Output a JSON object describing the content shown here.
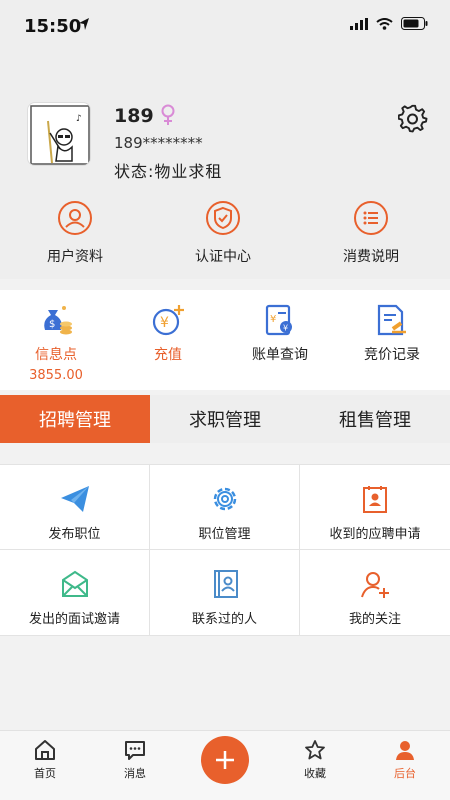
{
  "status_bar": {
    "time": "15:50"
  },
  "profile": {
    "name": "189",
    "phone": "189********",
    "status": "状态:物业求租"
  },
  "header_actions": [
    {
      "label": "用户资料",
      "icon": "user-profile-icon"
    },
    {
      "label": "认证中心",
      "icon": "shield-check-icon"
    },
    {
      "label": "消费说明",
      "icon": "list-doc-icon"
    }
  ],
  "wallet": [
    {
      "label": "信息点",
      "value": "3855.00",
      "icon": "money-bag-icon",
      "color": "#e8602c"
    },
    {
      "label": "充值",
      "icon": "yuan-plus-icon",
      "color": "#e8602c"
    },
    {
      "label": "账单查询",
      "icon": "bill-icon",
      "color": "#222222"
    },
    {
      "label": "竞价记录",
      "icon": "auction-doc-icon",
      "color": "#222222"
    }
  ],
  "tabs": [
    {
      "label": "招聘管理",
      "active": true
    },
    {
      "label": "求职管理",
      "active": false
    },
    {
      "label": "租售管理",
      "active": false
    }
  ],
  "grid": [
    {
      "label": "发布职位",
      "icon": "paper-plane-icon"
    },
    {
      "label": "职位管理",
      "icon": "gear-icon"
    },
    {
      "label": "收到的应聘申请",
      "icon": "resume-icon"
    },
    {
      "label": "发出的面试邀请",
      "icon": "envelope-icon"
    },
    {
      "label": "联系过的人",
      "icon": "contact-book-icon"
    },
    {
      "label": "我的关注",
      "icon": "user-add-icon"
    }
  ],
  "tabbar": [
    {
      "label": "首页",
      "icon": "home-icon"
    },
    {
      "label": "消息",
      "icon": "message-icon"
    },
    {
      "label": "收藏",
      "icon": "star-icon"
    },
    {
      "label": "后台",
      "icon": "person-icon",
      "active": true
    }
  ],
  "colors": {
    "accent": "#e8602c",
    "header_bg": "#eeeeee",
    "female": "#d98bd6"
  }
}
